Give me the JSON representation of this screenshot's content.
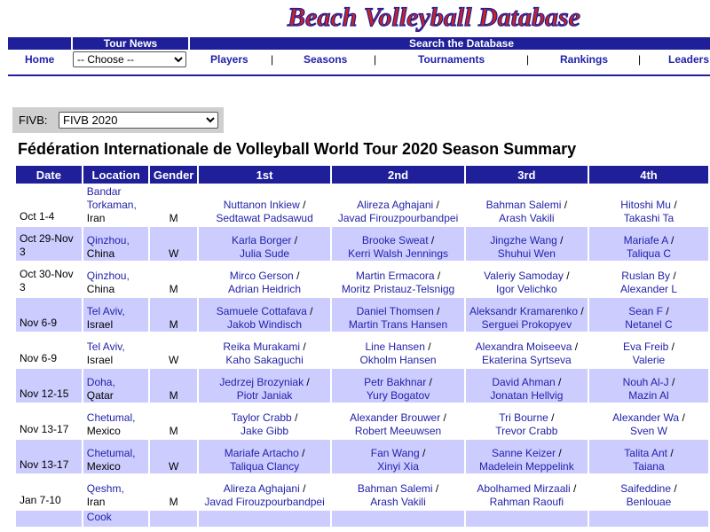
{
  "site": {
    "logo_text": "Beach Volleyball Database"
  },
  "nav": {
    "tour_news_label": "Tour News",
    "search_label": "Search the Database",
    "home": "Home",
    "choose": "-- Choose --",
    "players": "Players",
    "seasons": "Seasons",
    "tournaments": "Tournaments",
    "rankings": "Rankings",
    "leaders": "Leaders",
    "divider": "|"
  },
  "filter": {
    "label": "FIVB:",
    "selected": "FIVB 2020"
  },
  "page_title": "Fédération Internationale de Volleyball World Tour 2020 Season Summary",
  "table": {
    "headers": [
      "Date",
      "Location",
      "Gender",
      "1st",
      "2nd",
      "3rd",
      "4th"
    ],
    "rows": [
      {
        "date": "Oct 1-4",
        "loc_city": "Bandar Torkaman,",
        "loc_country": "Iran",
        "gender": "M",
        "r1a": "Nuttanon Inkiew",
        "r1b": "Sedtawat Padsawud",
        "r2a": "Alireza Aghajani",
        "r2b": "Javad Firouzpourbandpei",
        "r3a": "Bahman Salemi",
        "r3b": "Arash Vakili",
        "r4a": "Hitoshi Mu",
        "r4b": "Takashi Ta"
      },
      {
        "date": "Oct 29-Nov 3",
        "loc_city": "Qinzhou,",
        "loc_country": "China",
        "gender": "W",
        "r1a": "Karla Borger",
        "r1b": "Julia Sude",
        "r2a": "Brooke Sweat",
        "r2b": "Kerri Walsh Jennings",
        "r3a": "Jingzhe Wang",
        "r3b": "Shuhui Wen",
        "r4a": "Mariafe A",
        "r4b": "Taliqua C"
      },
      {
        "date": "Oct 30-Nov 3",
        "loc_city": "Qinzhou,",
        "loc_country": "China",
        "gender": "M",
        "r1a": "Mirco Gerson",
        "r1b": "Adrian Heidrich",
        "r2a": "Martin Ermacora",
        "r2b": "Moritz Pristauz-Telsnigg",
        "r3a": "Valeriy Samoday",
        "r3b": "Igor Velichko",
        "r4a": "Ruslan By",
        "r4b": "Alexander L"
      },
      {
        "date": "Nov 6-9",
        "loc_city": "Tel Aviv,",
        "loc_country": "Israel",
        "gender": "M",
        "r1a": "Samuele Cottafava",
        "r1b": "Jakob Windisch",
        "r2a": "Daniel Thomsen",
        "r2b": "Martin Trans Hansen",
        "r3a": "Aleksandr Kramarenko",
        "r3b": "Serguei Prokopyev",
        "r4a": "Sean F",
        "r4b": "Netanel C"
      },
      {
        "date": "Nov 6-9",
        "loc_city": "Tel Aviv,",
        "loc_country": "Israel",
        "gender": "W",
        "r1a": "Reika Murakami",
        "r1b": "Kaho Sakaguchi",
        "r2a": "Line Hansen",
        "r2b": "Okholm Hansen",
        "r3a": "Alexandra Moiseeva",
        "r3b": "Ekaterina Syrtseva",
        "r4a": "Eva Freib",
        "r4b": "Valerie"
      },
      {
        "date": "Nov 12-15",
        "loc_city": "Doha,",
        "loc_country": "Qatar",
        "gender": "M",
        "r1a": "Jedrzej Brozyniak",
        "r1b": "Piotr Janiak",
        "r2a": "Petr Bakhnar",
        "r2b": "Yury Bogatov",
        "r3a": "David Ahman",
        "r3b": "Jonatan Hellvig",
        "r4a": "Nouh Al-J",
        "r4b": "Mazin Al"
      },
      {
        "date": "Nov 13-17",
        "loc_city": "Chetumal,",
        "loc_country": "Mexico",
        "gender": "M",
        "r1a": "Taylor Crabb",
        "r1b": "Jake Gibb",
        "r2a": "Alexander Brouwer",
        "r2b": "Robert Meeuwsen",
        "r3a": "Tri Bourne",
        "r3b": "Trevor Crabb",
        "r4a": "Alexander Wa",
        "r4b": "Sven W"
      },
      {
        "date": "Nov 13-17",
        "loc_city": "Chetumal,",
        "loc_country": "Mexico",
        "gender": "W",
        "r1a": "Mariafe Artacho",
        "r1b": "Taliqua Clancy",
        "r2a": "Fan Wang",
        "r2b": "Xinyi Xia",
        "r3a": "Sanne Keizer",
        "r3b": "Madelein Meppelink",
        "r4a": "Talita Ant",
        "r4b": "Taiana"
      },
      {
        "date": "Jan 7-10",
        "loc_city": "Qeshm,",
        "loc_country": "Iran",
        "gender": "M",
        "r1a": "Alireza Aghajani",
        "r1b": "Javad Firouzpourbandpei",
        "r2a": "Bahman Salemi",
        "r2b": "Arash Vakili",
        "r3a": "Abolhamed Mirzaali",
        "r3b": "Rahman Raoufi",
        "r4a": "Saifeddine",
        "r4b": "Benlouae"
      },
      {
        "date": "",
        "loc_city": "Cook",
        "loc_country": "",
        "gender": "",
        "r1a": "",
        "r1b": "",
        "r2a": "",
        "r2b": "",
        "r3a": "",
        "r3b": "",
        "r4a": "",
        "r4b": ""
      }
    ],
    "pair_separator": " /"
  }
}
